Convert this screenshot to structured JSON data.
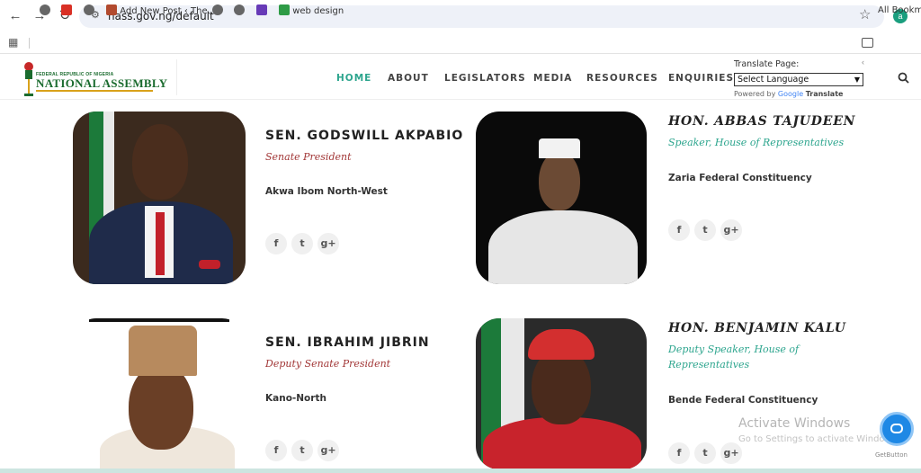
{
  "browser": {
    "url": "nass.gov.ng/default",
    "profile_initial": "a",
    "bookmarks": [
      {
        "label": "",
        "icon": "globe-icon"
      },
      {
        "label": "",
        "icon": "gmail-icon"
      },
      {
        "label": "",
        "icon": "globe-icon"
      },
      {
        "label": "Add New Post ‹ The...",
        "icon": "bookmark-site-icon"
      },
      {
        "label": "",
        "icon": "globe-icon"
      },
      {
        "label": "",
        "icon": "globe-icon"
      },
      {
        "label": "",
        "icon": "forms-icon"
      },
      {
        "label": "web design",
        "icon": "sheet-icon"
      }
    ],
    "all_bookmarks": "All Bookmar"
  },
  "site": {
    "logo_small": "FEDERAL REPUBLIC OF NIGERIA",
    "logo_big": "NATIONAL ASSEMBLY",
    "menu": [
      "HOME",
      "ABOUT",
      "LEGISLATORS",
      "MEDIA",
      "RESOURCES",
      "ENQUIRIES"
    ],
    "active_menu": "HOME",
    "translate": {
      "label": "Translate Page:",
      "close": "‹",
      "selected": "Select Language",
      "powered_by": "Powered by",
      "google": "Google",
      "translate_word": "Translate"
    }
  },
  "leaders": [
    {
      "name": "SEN. GODSWILL AKPABIO",
      "role": "Senate President",
      "constituency": "Akwa Ibom North-West"
    },
    {
      "name": "HON. ABBAS TAJUDEEN",
      "role": "Speaker, House of Representatives",
      "constituency": "Zaria Federal Constituency"
    },
    {
      "name": "SEN. IBRAHIM JIBRIN",
      "role": "Deputy Senate President",
      "constituency": "Kano-North"
    },
    {
      "name": "HON. BENJAMIN KALU",
      "role_line1": "Deputy Speaker, House of",
      "role_line2": "Representatives",
      "constituency": "Bende Federal Constituency"
    }
  ],
  "social_labels": {
    "facebook": "f",
    "twitter": "t",
    "googleplus": "g+"
  },
  "overlay": {
    "watermark_title": "Activate Windows",
    "watermark_sub": "Go to Settings to activate Windows.",
    "getbutton": "GetButton"
  },
  "colors": {
    "accent": "#2da58e",
    "role_red": "#a23737",
    "logo_green": "#1a6b2e"
  }
}
